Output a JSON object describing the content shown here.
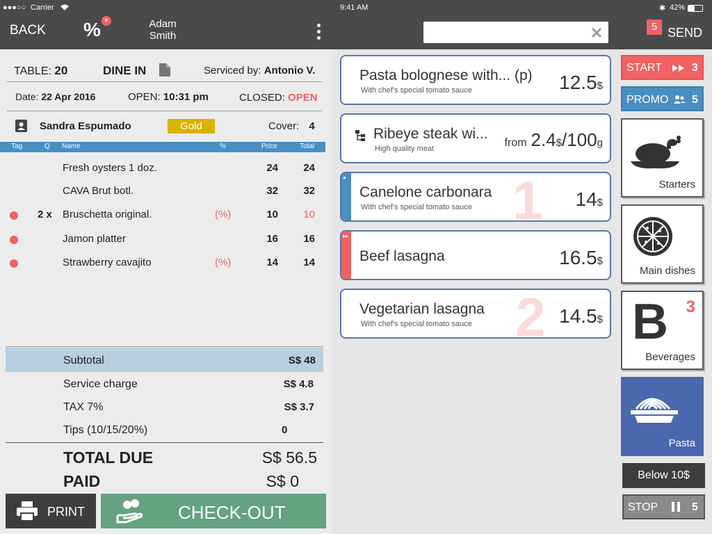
{
  "status_left": {
    "signal": "●●●○○",
    "carrier": "Carrier"
  },
  "status_right": {
    "time": "9:41 AM",
    "battery": "42%"
  },
  "topbar": {
    "back": "BACK",
    "percent": "%",
    "waiter_first": "Adam",
    "waiter_last": "Smith",
    "send": "SEND",
    "send_count": "5"
  },
  "search": {
    "placeholder": ""
  },
  "order": {
    "table_label": "TABLE:",
    "table_value": "20",
    "mode": "DINE IN",
    "serviced_label": "Serviced by:",
    "serviced_value": "Antonio V.",
    "date_label": "Date:",
    "date_value": "22 Apr 2016",
    "open_label": "OPEN:",
    "open_value": "10:31 pm",
    "closed_label": "CLOSED:",
    "closed_value": "OPEN",
    "customer": "Sandra Espumado",
    "tier": "Gold",
    "cover_label": "Cover:",
    "cover_value": "4"
  },
  "columns": {
    "tag": "Tag",
    "q": "Q",
    "name": "Name",
    "pct": "%",
    "price": "Price",
    "total": "Total"
  },
  "items": [
    {
      "tag": false,
      "q": "",
      "name": "Fresh oysters 1 doz.",
      "pct": "",
      "price": "24",
      "total": "24",
      "total_red": false
    },
    {
      "tag": false,
      "q": "",
      "name": "CAVA Brut botl.",
      "pct": "",
      "price": "32",
      "total": "32",
      "total_red": false
    },
    {
      "tag": true,
      "q": "2 x",
      "name": "Bruschetta original.",
      "pct": "(%)",
      "price": "10",
      "total": "10",
      "total_red": true
    },
    {
      "tag": true,
      "q": "",
      "name": "Jamon platter",
      "pct": "",
      "price": "16",
      "total": "16",
      "total_red": false
    },
    {
      "tag": true,
      "q": "",
      "name": "Strawberry cavajito",
      "pct": "(%)",
      "price": "14",
      "total": "14",
      "total_red": false
    }
  ],
  "totals": {
    "subtotal_label": "Subtotal",
    "subtotal": "S$ 48",
    "service_label": "Service charge",
    "service": "S$ 4.8",
    "tax_label": "TAX 7%",
    "tax": "S$ 3.7",
    "tips_label": "Tips (10/15/20%)",
    "tips": "0",
    "due_label": "TOTAL DUE",
    "due": "S$ 56.5",
    "paid_label": "PAID",
    "paid": "S$ 0"
  },
  "actions": {
    "print": "PRINT",
    "checkout": "CHECK-OUT"
  },
  "dishes": [
    {
      "title": "Pasta bolognese with... (p)",
      "sub": "With chef's special tomato sauce",
      "from": "",
      "price": "12.5",
      "unit": "$",
      "per": "",
      "badge": ""
    },
    {
      "title": "Ribeye steak wi...",
      "sub": "High quality meat",
      "from": "from",
      "price": "2.4",
      "unit": "$",
      "per": "/100",
      "per_unit": "g",
      "badge": ""
    },
    {
      "title": "Canelone carbonara",
      "sub": "With chef's special tomato sauce",
      "from": "",
      "price": "14",
      "unit": "$",
      "per": "",
      "badge": "1"
    },
    {
      "title": "Beef lasagna",
      "sub": "",
      "from": "",
      "price": "16.5",
      "unit": "$",
      "per": "",
      "badge": ""
    },
    {
      "title": "Vegetarian lasagna",
      "sub": "With chef's special tomato sauce",
      "from": "",
      "price": "14.5",
      "unit": "$",
      "per": "",
      "badge": "2"
    }
  ],
  "side": {
    "start": "START",
    "start_count": "3",
    "promo": "PROMO",
    "promo_count": "5",
    "starters": "Starters",
    "main": "Main dishes",
    "beverages": "Beverages",
    "beverages_letter": "B",
    "beverages_count": "3",
    "pasta": "Pasta",
    "below": "Below 10$",
    "stop": "STOP",
    "stop_count": "5"
  },
  "colors": {
    "accent_red": "#f06263",
    "blue": "#4a8ec2",
    "gold": "#d9b300",
    "checkout": "#64a280",
    "pasta_tile": "#4a68ae"
  }
}
